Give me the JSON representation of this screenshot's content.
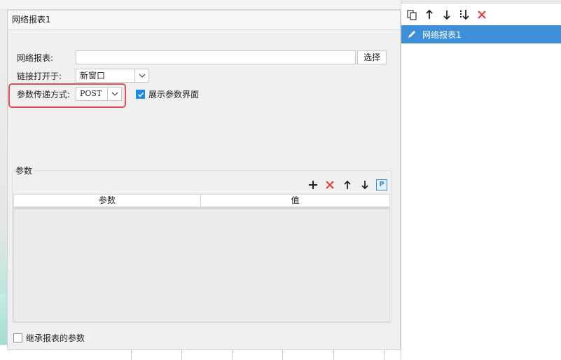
{
  "dialog": {
    "title": "网络报表1",
    "report_label": "网络报表:",
    "report_value": "",
    "select_button": "选择",
    "open_label": "链接打开于:",
    "open_value": "新窗口",
    "method_label": "参数传递方式:",
    "method_value": "POST",
    "show_param_label": "展示参数界面",
    "show_param_checked": true,
    "params_group_label": "参数",
    "table": {
      "columns": [
        "参数",
        "值"
      ],
      "rows": []
    },
    "inherit_label": "继承报表的参数",
    "inherit_checked": false
  },
  "right_panel": {
    "items": [
      {
        "label": "网络报表1",
        "selected": true
      }
    ]
  },
  "colors": {
    "accent": "#3d8fd9",
    "delete_red": "#e53935",
    "highlight": "#e24c5b",
    "checkbox_blue": "#1e88e5"
  },
  "icons": {
    "add": "plus-icon",
    "delete": "x-icon",
    "up": "arrow-up-icon",
    "down": "arrow-down-icon",
    "param": "p-icon",
    "copy": "copy-icon",
    "edit": "pencil-icon"
  }
}
